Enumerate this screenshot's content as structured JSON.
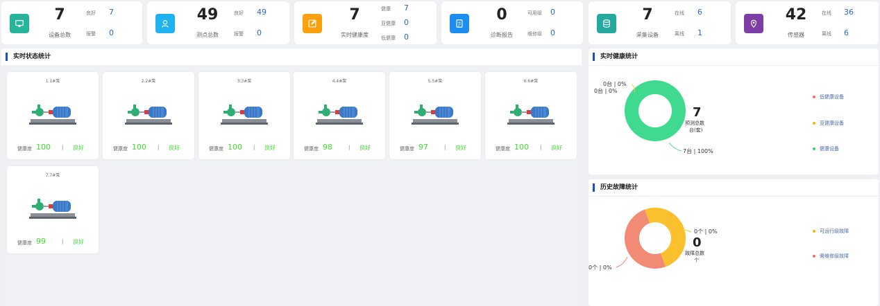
{
  "colors": {
    "accent": "#1e4fb8",
    "value_blue": "#2b66c9",
    "good_green": "#3ddc2c",
    "donut_green": "#3fd98f",
    "donut_yellow": "#fbc02d",
    "donut_salmon": "#f18b76",
    "legend_red": "#f36b5a",
    "legend_yellow": "#f7b500",
    "legend_green": "#2ecf87"
  },
  "stats": [
    {
      "icon": "monitor-icon",
      "color": "#26b59a",
      "value": "7",
      "caption": "设备总数",
      "sub": [
        {
          "label": "良好",
          "value": "7"
        },
        {
          "label": "报警",
          "value": "0"
        }
      ]
    },
    {
      "icon": "user-pin-icon",
      "color": "#1fb2ef",
      "value": "49",
      "caption": "测点总数",
      "sub": [
        {
          "label": "良好",
          "value": "49"
        },
        {
          "label": "报警",
          "value": "0"
        }
      ]
    },
    {
      "icon": "edit-icon",
      "color": "#fba10f",
      "value": "7",
      "caption": "实时健康度",
      "sub": [
        {
          "label": "健康",
          "value": "7"
        },
        {
          "label": "亚健康",
          "value": "0"
        },
        {
          "label": "低健康",
          "value": "0"
        }
      ]
    },
    {
      "icon": "report-icon",
      "color": "#1c8cf1",
      "value": "0",
      "caption": "诊断报告",
      "sub": [
        {
          "label": "可用级",
          "value": "0"
        },
        {
          "label": "维修级",
          "value": "0"
        }
      ]
    },
    {
      "icon": "database-icon",
      "color": "#23a9a0",
      "value": "7",
      "caption": "采集设备",
      "sub": [
        {
          "label": "在线",
          "value": "6"
        },
        {
          "label": "离线",
          "value": "1"
        }
      ]
    },
    {
      "icon": "location-icon",
      "color": "#7d3ea7",
      "value": "42",
      "caption": "传感器",
      "sub": [
        {
          "label": "在线",
          "value": "36"
        },
        {
          "label": "离线",
          "value": "6"
        }
      ]
    }
  ],
  "realtime": {
    "title": "实时状态统计",
    "health_label": "健康度",
    "separator": "|",
    "pumps": [
      {
        "name": "1.1#泵",
        "health": "100",
        "status": "良好"
      },
      {
        "name": "2.2#泵",
        "health": "100",
        "status": "良好"
      },
      {
        "name": "3.3#泵",
        "health": "100",
        "status": "良好"
      },
      {
        "name": "4.4#泵",
        "health": "98",
        "status": "良好"
      },
      {
        "name": "5.5#泵",
        "health": "97",
        "status": "良好"
      },
      {
        "name": "6.6#泵",
        "health": "100",
        "status": "良好"
      },
      {
        "name": "7.7#泵",
        "health": "99",
        "status": "良好"
      }
    ]
  },
  "health_stats": {
    "title": "实时健康统计",
    "center_value": "7",
    "center_line1": "预测总数",
    "center_line2": "台(套)",
    "labels": [
      "0台 | 0%",
      "0台 | 0%",
      "7台 | 100%"
    ],
    "legend": [
      "低健康设备",
      "亚健康设备",
      "健康设备"
    ]
  },
  "fault_stats": {
    "title": "历史故障统计",
    "center_value": "0",
    "center_line1": "故障总数",
    "center_line2": "个",
    "labels": [
      "0个 | 0%",
      "0个 | 0%"
    ],
    "legend": [
      "可运行级故障",
      "需维修级故障"
    ]
  },
  "chart_data": [
    {
      "type": "pie",
      "title": "实时健康统计",
      "categories": [
        "低健康设备",
        "亚健康设备",
        "健康设备"
      ],
      "values": [
        0,
        0,
        7
      ]
    },
    {
      "type": "pie",
      "title": "历史故障统计",
      "categories": [
        "可运行级故障",
        "需维修级故障"
      ],
      "values": [
        0,
        0
      ]
    }
  ]
}
